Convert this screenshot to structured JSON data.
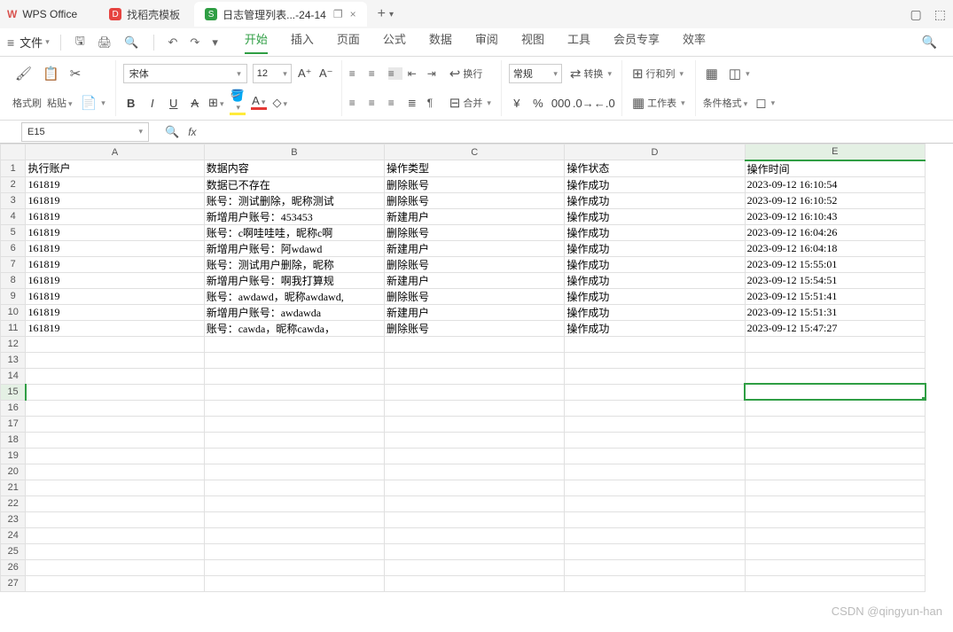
{
  "app_name": "WPS Office",
  "tabs": {
    "docer": "找稻壳模板",
    "file": "日志管理列表...-24-14",
    "file_icon_letter": "S",
    "docer_icon_letter": "D"
  },
  "menu": {
    "file": "文件",
    "items": [
      "开始",
      "插入",
      "页面",
      "公式",
      "数据",
      "审阅",
      "视图",
      "工具",
      "会员专享",
      "效率"
    ],
    "active_index": 0
  },
  "ribbon": {
    "format_painter": "格式刷",
    "paste": "粘贴",
    "font_name": "宋体",
    "font_size": "12",
    "wrap": "换行",
    "merge": "合并",
    "num_format": "常规",
    "convert": "转换",
    "rowcol": "行和列",
    "worksheet": "工作表",
    "cond_fmt": "条件格式"
  },
  "namebox": "E15",
  "fx_label": "fx",
  "columns": [
    "A",
    "B",
    "C",
    "D",
    "E"
  ],
  "row_count": 27,
  "active": {
    "row": 15,
    "col": 5
  },
  "headers": {
    "A": "执行账户",
    "B": "数据内容",
    "C": "操作类型",
    "D": "操作状态",
    "E": "操作时间"
  },
  "rows": [
    {
      "A": "161819",
      "B": "数据已不存在",
      "C": "删除账号",
      "D": "操作成功",
      "E": "2023-09-12 16:10:54"
    },
    {
      "A": "161819",
      "B": "账号：测试删除，昵称测试",
      "C": "删除账号",
      "D": "操作成功",
      "E": "2023-09-12 16:10:52"
    },
    {
      "A": "161819",
      "B": "新增用户账号：453453",
      "C": "新建用户",
      "D": "操作成功",
      "E": "2023-09-12 16:10:43"
    },
    {
      "A": "161819",
      "B": "账号：c啊哇哇哇，昵称c啊",
      "C": "删除账号",
      "D": "操作成功",
      "E": "2023-09-12 16:04:26"
    },
    {
      "A": "161819",
      "B": "新增用户账号：阿wdawd",
      "C": "新建用户",
      "D": "操作成功",
      "E": "2023-09-12 16:04:18"
    },
    {
      "A": "161819",
      "B": "账号：测试用户删除，昵称",
      "C": "删除账号",
      "D": "操作成功",
      "E": "2023-09-12 15:55:01"
    },
    {
      "A": "161819",
      "B": "新增用户账号：啊我打算规",
      "C": "新建用户",
      "D": "操作成功",
      "E": "2023-09-12 15:54:51"
    },
    {
      "A": "161819",
      "B": "账号：awdawd，昵称awdawd,",
      "C": "删除账号",
      "D": "操作成功",
      "E": "2023-09-12 15:51:41"
    },
    {
      "A": "161819",
      "B": "新增用户账号：awdawda",
      "C": "新建用户",
      "D": "操作成功",
      "E": "2023-09-12 15:51:31"
    },
    {
      "A": "161819",
      "B": "账号：cawda，昵称cawda，",
      "C": "删除账号",
      "D": "操作成功",
      "E": "2023-09-12 15:47:27"
    }
  ],
  "watermark": "CSDN @qingyun-han"
}
